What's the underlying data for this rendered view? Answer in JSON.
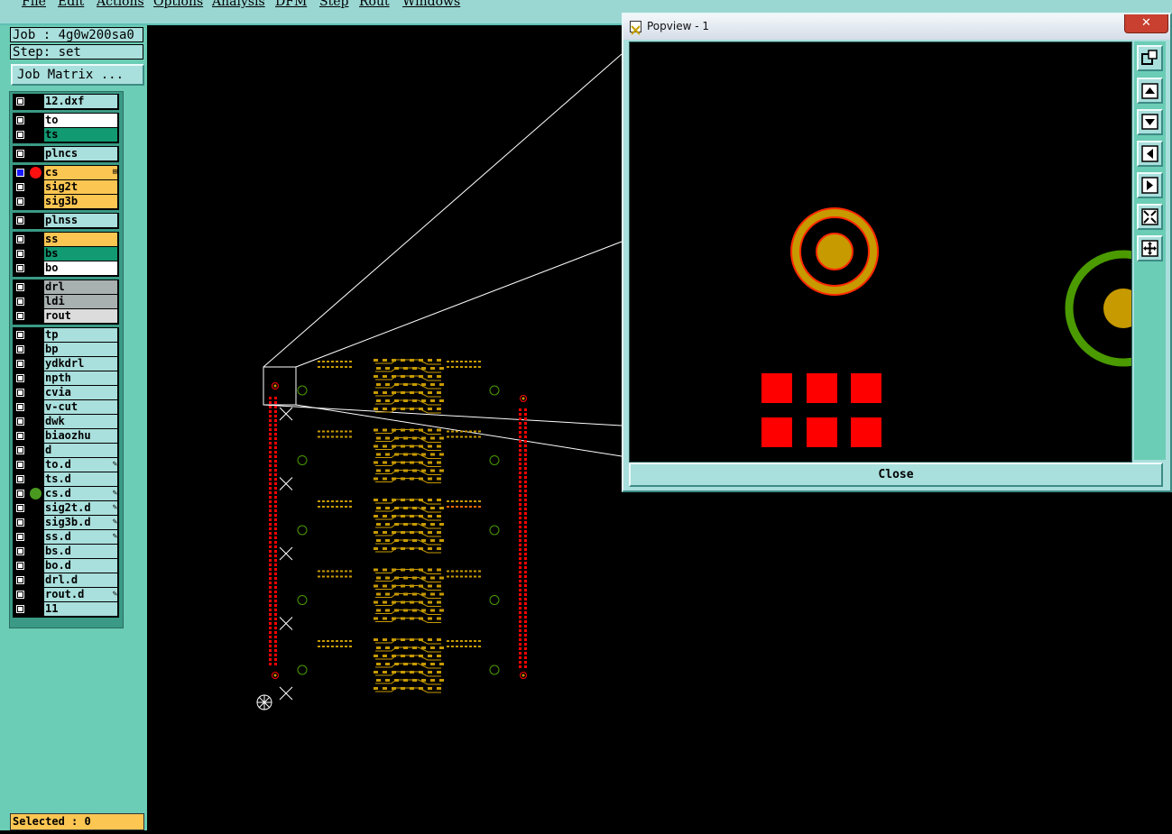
{
  "menubar": {
    "items": [
      "File",
      "Edit",
      "Actions",
      "Options",
      "Analysis",
      "DFM",
      "Step",
      "Rout",
      "Windows"
    ]
  },
  "job": {
    "label": "Job : 4g0w200sa0"
  },
  "step": {
    "label": "Step: set"
  },
  "job_matrix_label": "Job Matrix ...",
  "layers": [
    {
      "name": "12.dxf",
      "style": "teal"
    },
    {
      "name": "to",
      "style": "white"
    },
    {
      "name": "ts",
      "style": "green"
    },
    {
      "name": "plncs",
      "style": "teal"
    },
    {
      "name": "cs",
      "style": "orange",
      "active": true,
      "mark_color": "red"
    },
    {
      "name": "sig2t",
      "style": "orange"
    },
    {
      "name": "sig3b",
      "style": "orange"
    },
    {
      "name": "plnss",
      "style": "teal"
    },
    {
      "name": "ss",
      "style": "orange"
    },
    {
      "name": "bs",
      "style": "green"
    },
    {
      "name": "bo",
      "style": "white"
    },
    {
      "name": "drl",
      "style": "grey"
    },
    {
      "name": "ldi",
      "style": "grey"
    },
    {
      "name": "rout",
      "style": "lightgrey"
    },
    {
      "name": "tp",
      "style": "teal"
    },
    {
      "name": "bp",
      "style": "teal"
    },
    {
      "name": "ydkdrl",
      "style": "teal"
    },
    {
      "name": "npth",
      "style": "teal"
    },
    {
      "name": "cvia",
      "style": "teal"
    },
    {
      "name": "v-cut",
      "style": "teal"
    },
    {
      "name": "dwk",
      "style": "teal"
    },
    {
      "name": "biaozhu",
      "style": "teal"
    },
    {
      "name": "d",
      "style": "teal"
    },
    {
      "name": "to.d",
      "style": "teal"
    },
    {
      "name": "ts.d",
      "style": "teal"
    },
    {
      "name": "cs.d",
      "style": "teal",
      "mark_color": "green"
    },
    {
      "name": "sig2t.d",
      "style": "teal"
    },
    {
      "name": "sig3b.d",
      "style": "teal"
    },
    {
      "name": "ss.d",
      "style": "teal"
    },
    {
      "name": "bs.d",
      "style": "teal"
    },
    {
      "name": "bo.d",
      "style": "teal"
    },
    {
      "name": "drl.d",
      "style": "teal"
    },
    {
      "name": "rout.d",
      "style": "teal"
    },
    {
      "name": "11",
      "style": "teal"
    }
  ],
  "status": {
    "selected_label": "Selected : 0"
  },
  "popview": {
    "title": "Popview - 1",
    "close_label": "Close",
    "close_x": "✕"
  },
  "colors": {
    "teal": "#a9dfdc",
    "panel": "#6bcdb5",
    "orange": "#fcc652",
    "green": "#129a72",
    "pcb_red": "#ff0000",
    "pcb_gold": "#c79a00",
    "pcb_green": "#4a9a00"
  },
  "icons": [
    "zoom-window-icon",
    "pan-up-icon",
    "pan-down-icon",
    "pan-left-icon",
    "pan-right-icon",
    "zoom-fit-icon",
    "zoom-home-icon"
  ]
}
